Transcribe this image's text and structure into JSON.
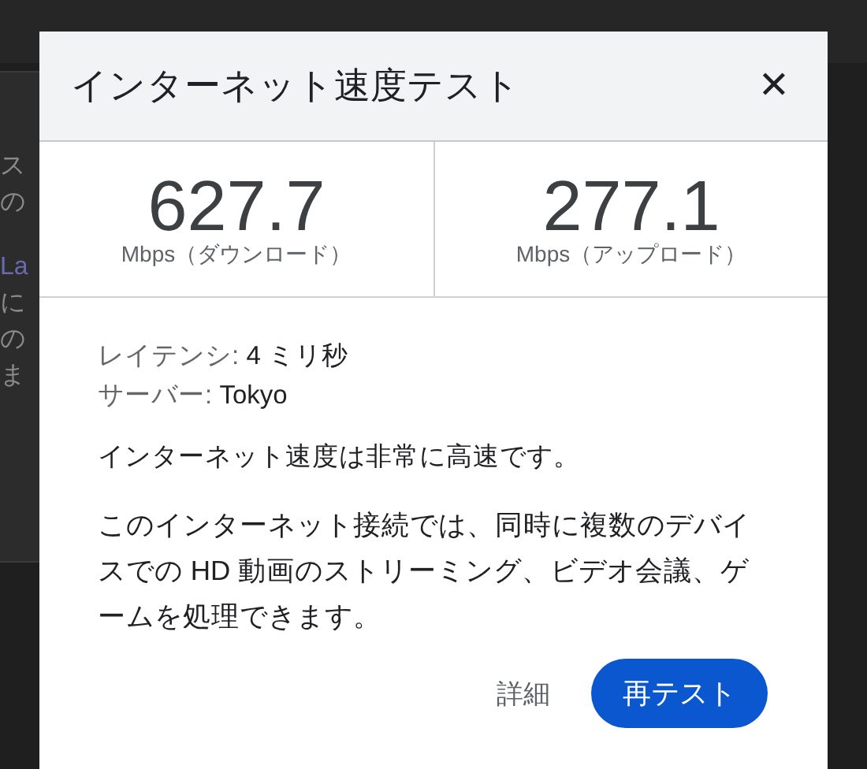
{
  "background_page": {
    "text_fragments": [
      "ス",
      "の",
      "La",
      "に",
      "の",
      "ま"
    ]
  },
  "dialog": {
    "title": "インターネット速度テスト",
    "close_label": "✕",
    "results": [
      {
        "value": "627.7",
        "unit": "Mbps（ダウンロード）"
      },
      {
        "value": "277.1",
        "unit": "Mbps（アップロード）"
      }
    ],
    "details": [
      {
        "label": "レイテンシ:",
        "value": "4 ミリ秒"
      },
      {
        "label": "サーバー:",
        "value": "Tokyo"
      }
    ],
    "summary": "インターネット速度は非常に高速です。",
    "description": "このインターネット接続では、同時に複数のデバイスでの HD 動画のストリーミング、ビデオ会議、ゲームを処理できます。",
    "buttons": [
      {
        "label": "詳細",
        "kind": "text"
      },
      {
        "label": "再テスト",
        "kind": "filled"
      }
    ]
  }
}
